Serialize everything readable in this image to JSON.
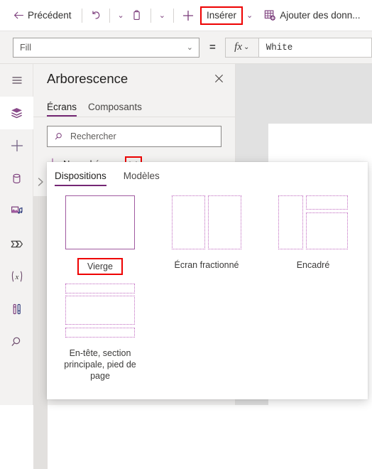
{
  "toolbar": {
    "back_label": "Précédent",
    "back_icon": "arrow-left-icon",
    "undo_icon": "undo-icon",
    "undo_caret": "⌄",
    "clipboard_icon": "clipboard-icon",
    "clipboard_caret": "⌄",
    "plus_icon": "plus-icon",
    "insert_label": "Insérer",
    "insert_caret": "⌄",
    "add_data_icon": "add-data-table-icon",
    "add_data_label": "Ajouter des donn..."
  },
  "formula_bar": {
    "property_value": "Fill",
    "property_caret": "⌄",
    "equals": "=",
    "fx_symbol": "fx",
    "fx_caret": "⌄",
    "formula_value": "White"
  },
  "rail": {
    "items": [
      {
        "icon": "hamburger-menu-icon",
        "name": "menu"
      },
      {
        "icon": "layers-tree-icon",
        "name": "tree-view",
        "active": true
      },
      {
        "icon": "plus-insert-icon",
        "name": "insert"
      },
      {
        "icon": "database-icon",
        "name": "data"
      },
      {
        "icon": "media-icon",
        "name": "media"
      },
      {
        "icon": "power-automate-icon",
        "name": "power-automate"
      },
      {
        "icon": "variables-icon",
        "name": "variables"
      },
      {
        "icon": "tools-icon",
        "name": "tools"
      },
      {
        "icon": "search-icon",
        "name": "search"
      }
    ]
  },
  "tree_panel": {
    "title": "Arborescence",
    "close_icon": "close-icon",
    "expander_icon": "chevron-right-icon",
    "tabs": [
      {
        "label": "Écrans",
        "active": true
      },
      {
        "label": "Composants",
        "active": false
      }
    ],
    "search": {
      "icon": "search-icon",
      "placeholder": "Rechercher"
    },
    "new_screen": {
      "plus_icon": "plus-icon",
      "label": "Nouvel écran",
      "caret_icon": "chevron-down-icon",
      "caret": "⌄",
      "highlighted": true
    }
  },
  "flyout": {
    "tabs": [
      {
        "label": "Dispositions",
        "active": true
      },
      {
        "label": "Modèles",
        "active": false
      }
    ],
    "layouts": [
      {
        "caption": "Vierge",
        "highlighted": true,
        "style": "blank"
      },
      {
        "caption": "Écran fractionné",
        "highlighted": false,
        "style": "split"
      },
      {
        "caption": "Encadré",
        "highlighted": false,
        "style": "sidebar"
      },
      {
        "caption": "En-tête, section principale, pied de page",
        "highlighted": false,
        "style": "header-main-footer"
      }
    ]
  },
  "colors": {
    "accent": "#742774",
    "accent_light": "#a05aa0",
    "dotted": "#bf67bf",
    "highlight_red": "#ee0000",
    "panel_bg": "#f3f2f1",
    "canvas_bg": "#e1e1e1"
  }
}
